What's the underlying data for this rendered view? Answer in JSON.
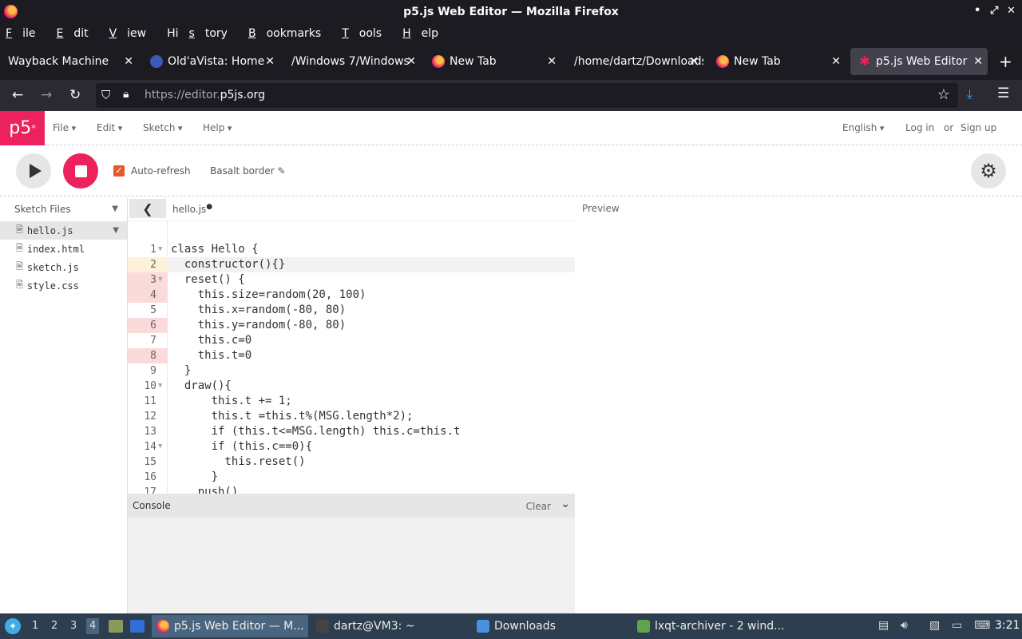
{
  "window": {
    "title": "p5.js Web Editor — Mozilla Firefox",
    "controls": [
      "•",
      "⤢",
      "✕"
    ]
  },
  "menubar": [
    {
      "u": "F",
      "rest": "ile"
    },
    {
      "u": "E",
      "rest": "dit"
    },
    {
      "u": "V",
      "rest": "iew"
    },
    {
      "pre": "Hi",
      "u": "s",
      "rest": "tory"
    },
    {
      "u": "B",
      "rest": "ookmarks"
    },
    {
      "u": "T",
      "rest": "ools"
    },
    {
      "u": "H",
      "rest": "elp"
    }
  ],
  "tabs": [
    {
      "label": "Wayback Machine",
      "icon": "none"
    },
    {
      "label": "Old'aVista: Home",
      "icon": "globe"
    },
    {
      "label": "/Windows 7/Windows",
      "icon": "none"
    },
    {
      "label": "New Tab",
      "icon": "firefox"
    },
    {
      "label": "/home/dartz/Downloads",
      "icon": "none"
    },
    {
      "label": "New Tab",
      "icon": "firefox"
    },
    {
      "label": "p5.js Web Editor",
      "icon": "p5-star",
      "active": true
    }
  ],
  "address": {
    "prefix": "https://editor.",
    "domain": "p5js.org"
  },
  "p5": {
    "logo": "p5",
    "logo_sup": "*",
    "menus": [
      "File",
      "Edit",
      "Sketch",
      "Help"
    ],
    "language": "English",
    "login": "Log in",
    "or": "or",
    "signup": "Sign up",
    "auto_refresh": "Auto-refresh",
    "sketch_name": "Basalt border",
    "sketch_files_label": "Sketch Files",
    "files": [
      {
        "name": "hello.js",
        "selected": true
      },
      {
        "name": "index.html"
      },
      {
        "name": "sketch.js"
      },
      {
        "name": "style.css"
      }
    ],
    "current_file": "hello.js",
    "preview_label": "Preview",
    "console_label": "Console",
    "clear_label": "Clear"
  },
  "code": [
    {
      "n": "1",
      "text": "class Hello {",
      "fold": true
    },
    {
      "n": "2",
      "text": "  constructor(){}",
      "marker": "yellow",
      "active": true
    },
    {
      "n": "3",
      "text": "  reset() {",
      "fold": true,
      "marker": "red"
    },
    {
      "n": "4",
      "text": "    this.size=random(20, 100)",
      "marker": "red"
    },
    {
      "n": "5",
      "text": "    this.x=random(-80, 80)"
    },
    {
      "n": "6",
      "text": "    this.y=random(-80, 80)",
      "marker": "red"
    },
    {
      "n": "7",
      "text": "    this.c=0"
    },
    {
      "n": "8",
      "text": "    this.t=0",
      "marker": "red"
    },
    {
      "n": "9",
      "text": "  }"
    },
    {
      "n": "10",
      "text": "  draw(){",
      "fold": true
    },
    {
      "n": "11",
      "text": "      this.t += 1;"
    },
    {
      "n": "12",
      "text": "      this.t =this.t%(MSG.length*2);"
    },
    {
      "n": "13",
      "text": "      if (this.t<=MSG.length) this.c=this.t"
    },
    {
      "n": "14",
      "text": "      if (this.c==0){",
      "fold": true
    },
    {
      "n": "15",
      "text": "        this.reset()"
    },
    {
      "n": "16",
      "text": "      }"
    },
    {
      "n": "17",
      "text": "    push()"
    }
  ],
  "taskbar": {
    "desktops": [
      "1",
      "2",
      "3",
      "4"
    ],
    "tasks": [
      {
        "label": "p5.js Web Editor — M...",
        "active": true
      },
      {
        "label": "dartz@VM3: ~"
      },
      {
        "label": "Downloads"
      },
      {
        "label": "lxqt-archiver - 2 wind..."
      }
    ],
    "clock": "3:21"
  }
}
